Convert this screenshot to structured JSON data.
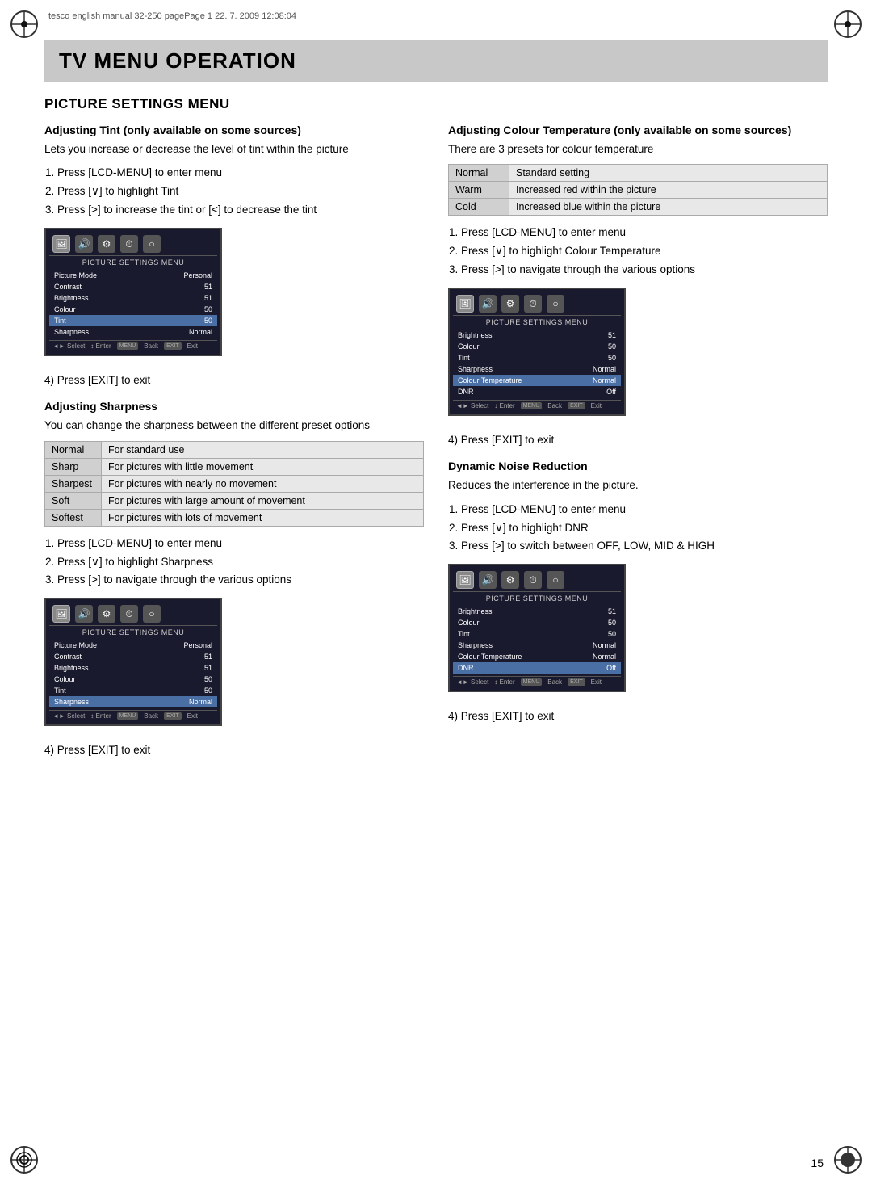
{
  "header": {
    "text": "tesco english manual 32-250 pagePage 1  22. 7. 2009  12:08:04"
  },
  "page_number": "15",
  "title_banner": {
    "text": "TV MENU OPERATION"
  },
  "section_heading": "PICTURE SETTINGS MENU",
  "left_col": {
    "tint_heading": "Adjusting Tint (only available on some sources)",
    "tint_para1": "Lets you increase or decrease the level of tint within the picture",
    "tint_steps": [
      "Press [LCD-MENU] to enter menu",
      "Press [∨] to highlight Tint",
      "Press [>] to increase the tint or [<] to decrease the tint"
    ],
    "tint_exit": "4) Press [EXIT] to exit",
    "sharpness_heading": "Adjusting Sharpness",
    "sharpness_para": "You can change the sharpness between the different preset options",
    "sharpness_table": [
      {
        "label": "Normal",
        "desc": "For standard use"
      },
      {
        "label": "Sharp",
        "desc": "For pictures with little movement"
      },
      {
        "label": "Sharpest",
        "desc": "For pictures with nearly no movement"
      },
      {
        "label": "Soft",
        "desc": "For pictures with large amount of movement"
      },
      {
        "label": "Softest",
        "desc": "For pictures with lots of movement"
      }
    ],
    "sharpness_steps": [
      "Press [LCD-MENU] to enter menu",
      "Press [∨] to highlight Sharpness",
      "Press [>] to navigate through the various options"
    ],
    "sharpness_exit": "4) Press [EXIT] to exit",
    "tv_menu1": {
      "title": "PICTURE SETTINGS MENU",
      "rows": [
        {
          "label": "Picture Mode",
          "value": "Personal",
          "highlighted": false
        },
        {
          "label": "Contrast",
          "value": "51",
          "highlighted": false
        },
        {
          "label": "Brightness",
          "value": "51",
          "highlighted": false
        },
        {
          "label": "Colour",
          "value": "50",
          "highlighted": false
        },
        {
          "label": "Tint",
          "value": "50",
          "highlighted": true
        },
        {
          "label": "Sharpness",
          "value": "Normal",
          "highlighted": false
        }
      ],
      "footer": "◄► Select  ↕ Enter  MENU Back  EXIT Exit"
    },
    "tv_menu3": {
      "title": "PICTURE SETTINGS MENU",
      "rows": [
        {
          "label": "Picture Mode",
          "value": "Personal",
          "highlighted": false
        },
        {
          "label": "Contrast",
          "value": "51",
          "highlighted": false
        },
        {
          "label": "Brightness",
          "value": "51",
          "highlighted": false
        },
        {
          "label": "Colour",
          "value": "50",
          "highlighted": false
        },
        {
          "label": "Tint",
          "value": "50",
          "highlighted": false
        },
        {
          "label": "Sharpness",
          "value": "Normal",
          "highlighted": true
        }
      ],
      "footer": "◄► Select  ↕ Enter  MENU Back  EXIT Exit"
    }
  },
  "right_col": {
    "colour_temp_heading": "Adjusting Colour Temperature (only available on some sources)",
    "colour_temp_para": "There are 3 presets for colour temperature",
    "colour_temp_table": [
      {
        "label": "Normal",
        "desc": "Standard setting"
      },
      {
        "label": "Warm",
        "desc": "Increased red within the picture"
      },
      {
        "label": "Cold",
        "desc": "Increased blue within the picture"
      }
    ],
    "colour_temp_steps": [
      "Press [LCD-MENU] to enter menu",
      "Press [∨] to highlight Colour Temperature",
      "Press [>] to navigate through the various options"
    ],
    "colour_temp_exit": "4) Press [EXIT] to exit",
    "tv_menu2": {
      "title": "PICTURE SETTINGS MENU",
      "rows": [
        {
          "label": "Brightness",
          "value": "51",
          "highlighted": false
        },
        {
          "label": "Colour",
          "value": "50",
          "highlighted": false
        },
        {
          "label": "Tint",
          "value": "50",
          "highlighted": false
        },
        {
          "label": "Sharpness",
          "value": "Normal",
          "highlighted": false
        },
        {
          "label": "Colour Temperature",
          "value": "Normal",
          "highlighted": true
        },
        {
          "label": "DNR",
          "value": "Off",
          "highlighted": false
        }
      ],
      "footer": "◄► Select  ↕ Enter  MENU Back  EXIT Exit"
    },
    "dnr_heading": "Dynamic Noise Reduction",
    "dnr_para": "Reduces the interference in the picture.",
    "dnr_steps": [
      "Press [LCD-MENU] to enter menu",
      "Press [∨] to highlight DNR",
      "Press [>] to switch between OFF, LOW, MID & HIGH"
    ],
    "dnr_exit": "4) Press [EXIT] to exit",
    "tv_menu4": {
      "title": "PICTURE SETTINGS MENU",
      "rows": [
        {
          "label": "Brightness",
          "value": "51",
          "highlighted": false
        },
        {
          "label": "Colour",
          "value": "50",
          "highlighted": false
        },
        {
          "label": "Tint",
          "value": "50",
          "highlighted": false
        },
        {
          "label": "Sharpness",
          "value": "Normal",
          "highlighted": false
        },
        {
          "label": "Colour Temperature",
          "value": "Normal",
          "highlighted": false
        },
        {
          "label": "DNR",
          "value": "Off",
          "highlighted": true
        }
      ],
      "footer": "◄► Select  ↕ Enter  MENU Back  EXIT Exit"
    }
  }
}
